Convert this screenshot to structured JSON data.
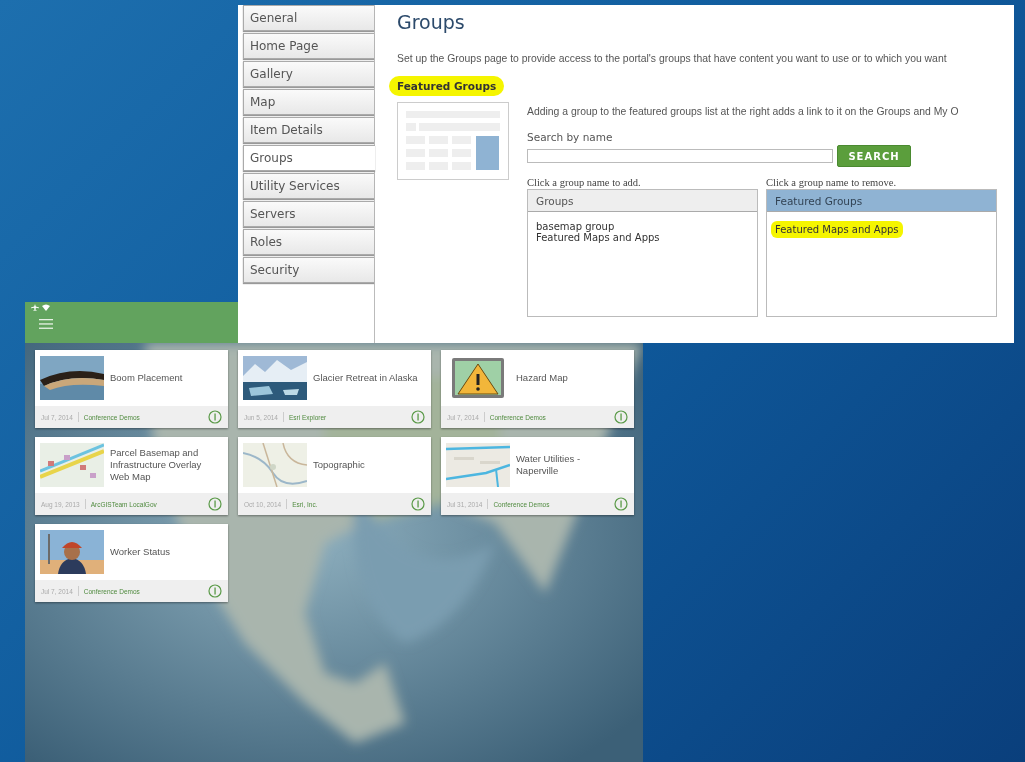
{
  "admin_window": {
    "sidebar": {
      "items": [
        {
          "label": "General",
          "selected": false
        },
        {
          "label": "Home Page",
          "selected": false
        },
        {
          "label": "Gallery",
          "selected": false
        },
        {
          "label": "Map",
          "selected": false
        },
        {
          "label": "Item Details",
          "selected": false
        },
        {
          "label": "Groups",
          "selected": true
        },
        {
          "label": "Utility Services",
          "selected": false
        },
        {
          "label": "Servers",
          "selected": false
        },
        {
          "label": "Roles",
          "selected": false
        },
        {
          "label": "Security",
          "selected": false
        }
      ]
    },
    "title": "Groups",
    "intro": "Set up the Groups page to provide access to the portal's groups that have content you want to use or to which you want",
    "section_heading": {
      "text": "Featured Groups",
      "highlighted": true
    },
    "description": "Adding a group to the featured groups list at the right adds a link to it on the Groups and My O",
    "search": {
      "label": "Search by name",
      "button": "SEARCH"
    },
    "available": {
      "caption": "Click a group name to add.",
      "header": "Groups",
      "items": [
        {
          "label": "basemap group",
          "highlighted": false
        },
        {
          "label": "Featured Maps and Apps",
          "highlighted": false
        }
      ]
    },
    "featured": {
      "caption": "Click a group name to remove.",
      "header": "Featured Groups",
      "items": [
        {
          "label": "Featured Maps and Apps",
          "highlighted": true
        }
      ]
    }
  },
  "mobile_app": {
    "items": [
      {
        "title": "Boom Placement",
        "date": "Jul 7, 2014",
        "owner": "Conference Demos",
        "kind": "picture"
      },
      {
        "title": "Glacier Retreat in Alaska",
        "date": "Jun 5, 2014",
        "owner": "Esri Explorer",
        "kind": "picture"
      },
      {
        "title": "Hazard Map",
        "date": "Jul 7, 2014",
        "owner": "Conference Demos",
        "kind": "icon"
      },
      {
        "title": "Parcel Basemap and Infrastructure Overlay Web Map",
        "date": "Aug 19, 2013",
        "owner": "ArcGISTeam LocalGov",
        "kind": "picture"
      },
      {
        "title": "Topographic",
        "date": "Oct 10, 2014",
        "owner": "Esri, Inc.",
        "kind": "picture"
      },
      {
        "title": "Water Utilities - Naperville",
        "date": "Jul 31, 2014",
        "owner": "Conference Demos",
        "kind": "picture"
      },
      {
        "title": "Worker Status",
        "date": "Jul 7, 2014",
        "owner": "Conference Demos",
        "kind": "picture"
      }
    ]
  }
}
